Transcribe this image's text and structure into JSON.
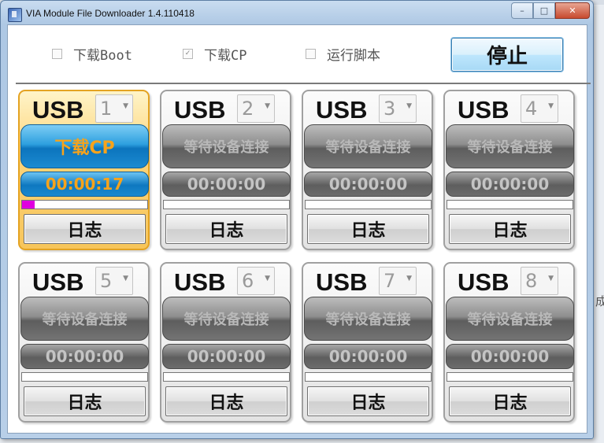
{
  "window": {
    "title": "VIA Module File Downloader 1.4.110418",
    "controls": {
      "minimize": "–",
      "maximize": "□",
      "close": "✕"
    }
  },
  "toolbar": {
    "options": [
      {
        "label": "下载Boot",
        "checked": false
      },
      {
        "label": "下载CP",
        "checked": true
      },
      {
        "label": "运行脚本",
        "checked": false
      }
    ],
    "stop_label": "停止"
  },
  "ports": [
    {
      "name": "USB",
      "number": "1",
      "status": "下载CP",
      "time": "00:00:17",
      "progress": 0.1,
      "log_label": "日志",
      "active": true
    },
    {
      "name": "USB",
      "number": "2",
      "status": "等待设备连接",
      "time": "00:00:00",
      "progress": 0,
      "log_label": "日志",
      "active": false
    },
    {
      "name": "USB",
      "number": "3",
      "status": "等待设备连接",
      "time": "00:00:00",
      "progress": 0,
      "log_label": "日志",
      "active": false
    },
    {
      "name": "USB",
      "number": "4",
      "status": "等待设备连接",
      "time": "00:00:00",
      "progress": 0,
      "log_label": "日志",
      "active": false
    },
    {
      "name": "USB",
      "number": "5",
      "status": "等待设备连接",
      "time": "00:00:00",
      "progress": 0,
      "log_label": "日志",
      "active": false
    },
    {
      "name": "USB",
      "number": "6",
      "status": "等待设备连接",
      "time": "00:00:00",
      "progress": 0,
      "log_label": "日志",
      "active": false
    },
    {
      "name": "USB",
      "number": "7",
      "status": "等待设备连接",
      "time": "00:00:00",
      "progress": 0,
      "log_label": "日志",
      "active": false
    },
    {
      "name": "USB",
      "number": "8",
      "status": "等待设备连接",
      "time": "00:00:00",
      "progress": 0,
      "log_label": "日志",
      "active": false
    }
  ],
  "background_edge_text": "成"
}
